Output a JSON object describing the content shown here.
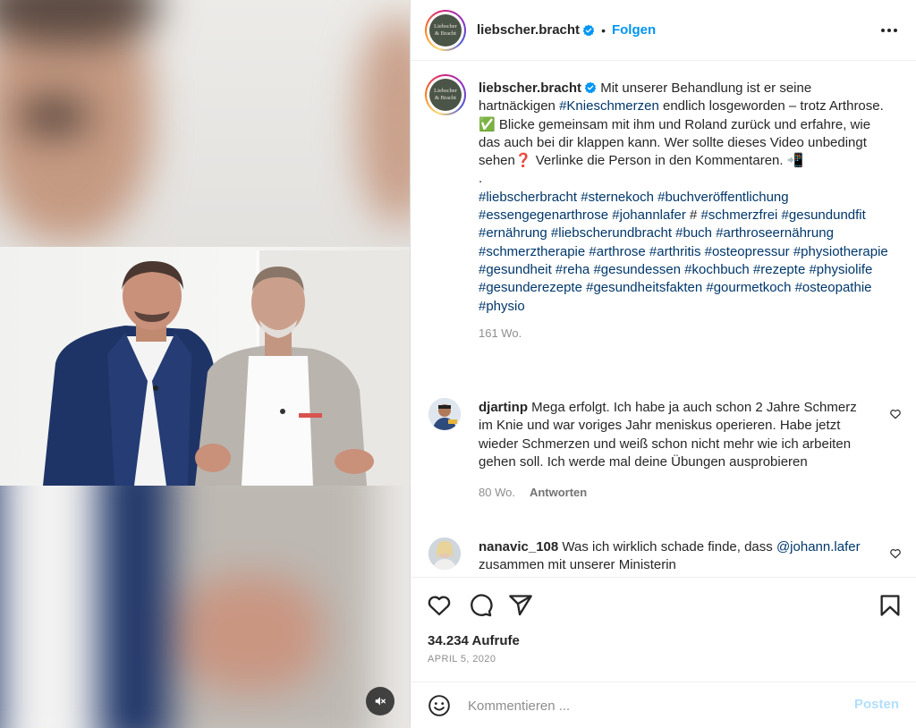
{
  "account": {
    "username": "liebscher.bracht",
    "logo_text": "Liebscher & Bracht",
    "follow_label": "Folgen",
    "dot": "•"
  },
  "caption": {
    "username": "liebscher.bracht",
    "text_1": "Mit unserer Behandlung ist er seine hartnäckigen",
    "hashtag_1": "#Knieschmerzen",
    "text_2": "endlich losgeworden – trotz Arthrose. ✅ Blicke gemeinsam mit ihm und Roland zurück und erfahre, wie das auch bei dir klappen kann. Wer sollte dieses Video unbedingt sehen❓ Verlinke die Person in den Kommentaren. 📲",
    "separator": ".",
    "hashtags_a": "#liebscherbracht #sternekoch #buchveröffentlichung #essengegenarthrose #johannlafer",
    "hash_plain": " # ",
    "hashtags_b": "#schmerzfrei #gesundundfit #ernährung #liebscherundbracht #buch #arthroseernährung #schmerztherapie #arthrose #arthritis #osteopressur #physiotherapie #gesundheit #reha #gesundessen #kochbuch #rezepte #physiolife #gesunderezepte #gesundheitsfakten #gourmetkoch #osteopathie #physio",
    "time": "161 Wo."
  },
  "comments": [
    {
      "username": "djartinp",
      "text": "Mega erfolgt. Ich habe ja auch schon 2 Jahre Schmerz im Knie und war voriges Jahr meniskus operieren. Habe jetzt wieder Schmerzen und weiß schon nicht mehr wie ich arbeiten gehen soll. Ich werde mal deine Übungen ausprobieren",
      "time": "80 Wo.",
      "reply_label": "Antworten"
    },
    {
      "username": "nanavic_108",
      "text_1": "Was ich wirklich schade finde, dass",
      "mention": "@johann.lafer",
      "text_2": "zusammen mit unserer Ministerin"
    }
  ],
  "stats": {
    "views": "34.234 Aufrufe",
    "date": "APRIL 5, 2020"
  },
  "comment_box": {
    "placeholder": "Kommentieren ...",
    "post_label": "Posten"
  },
  "colors": {
    "accent": "#0095f6",
    "hashtag": "#00376b",
    "muted": "#8e8e8e",
    "post_disabled": "#b2dffc"
  }
}
